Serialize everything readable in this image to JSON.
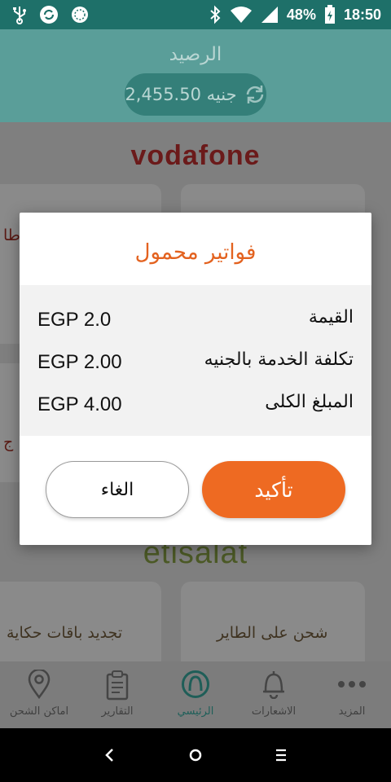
{
  "status_bar": {
    "battery": "48%",
    "time": "18:50",
    "icons": [
      "usb-icon",
      "sync-app-icon",
      "globe-app-icon",
      "bluetooth-icon",
      "wifi-icon",
      "signal-icon",
      "battery-charging-icon"
    ]
  },
  "header": {
    "title": "الرصيد",
    "balance": "2,455.50 جنيه",
    "refresh_icon": "refresh-icon"
  },
  "background": {
    "brand_top": "vodafone",
    "brand_bottom": "etisalat",
    "left_partial_1": "طا",
    "left_partial_2": "ج",
    "card_etisalat_right": "شحن على الطاير",
    "card_etisalat_left": "تجديد باقات حكاية"
  },
  "dialog": {
    "title": "فواتير محمول",
    "rows": [
      {
        "label": "القيمة",
        "value": "EGP 2.0"
      },
      {
        "label": "تكلفة الخدمة بالجنيه",
        "value": "EGP 2.00"
      },
      {
        "label": "المبلغ الكلى",
        "value": "EGP 4.00"
      }
    ],
    "confirm_label": "تأكيد",
    "cancel_label": "الغاء"
  },
  "bottom_nav": {
    "items": [
      {
        "label": "اماكن الشحن",
        "icon": "location-pin-icon",
        "active": false
      },
      {
        "label": "التقارير",
        "icon": "clipboard-icon",
        "active": false
      },
      {
        "label": "الرئيسي",
        "icon": "home-logo-icon",
        "active": true
      },
      {
        "label": "الاشعارات",
        "icon": "bell-icon",
        "active": false
      },
      {
        "label": "المزيد",
        "icon": "more-dots-icon",
        "active": false
      }
    ]
  },
  "colors": {
    "accent": "#ee6a22",
    "header_teal": "#1e7069",
    "title_orange": "#e3621f"
  }
}
